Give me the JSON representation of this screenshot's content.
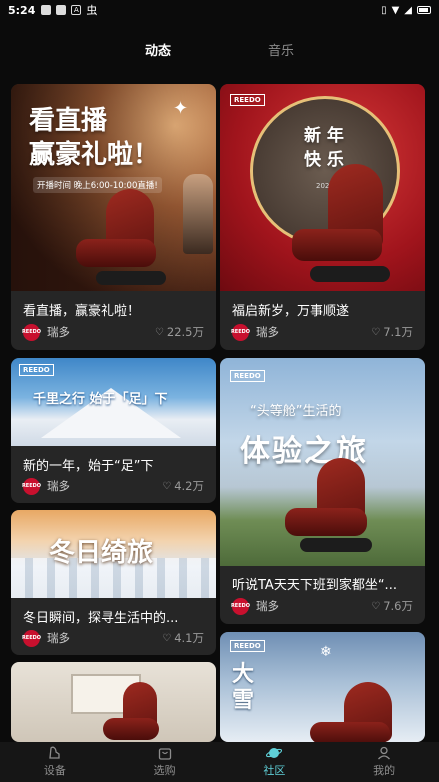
{
  "status": {
    "time": "5:24",
    "icons": [
      "sq-icon",
      "sq-icon",
      "a-icon",
      "bug-icon"
    ],
    "right": [
      "vibrate-icon",
      "data-icon",
      "wifi-icon",
      "signal-icon",
      "battery-icon"
    ]
  },
  "tabs": {
    "active": "动态",
    "inactive": "音乐"
  },
  "brand_tag": "REEDO",
  "cards": [
    {
      "title": "看直播，赢豪礼啦！",
      "author": "瑞多",
      "likes": "22.5万",
      "overlay": "看直播\n赢豪礼啦！",
      "sub": "开播时间  晚上6:00-10:00直播!"
    },
    {
      "title": "福启新岁，万事顺遂",
      "author": "瑞多",
      "likes": "7.1万",
      "overlay": "新 年\n快 乐",
      "sub": "2024"
    },
    {
      "title": "新的一年，始于“足”下",
      "author": "瑞多",
      "likes": "4.2万",
      "overlay": "千里之行  始于「足」下"
    },
    {
      "title": "听说TA天天下班到家都坐“...",
      "author": "瑞多",
      "likes": "7.6万",
      "overlay_small": "“头等舱”生活的",
      "overlay": "体验之旅"
    },
    {
      "title": "冬日瞬间，探寻生活中的...",
      "author": "瑞多",
      "likes": "4.1万",
      "overlay": "冬日绮旅"
    },
    {
      "title": "",
      "author": "",
      "likes": "",
      "overlay": ""
    },
    {
      "title": "",
      "author": "",
      "likes": "",
      "overlay": "大\n雪"
    }
  ],
  "nav": [
    {
      "label": "设备",
      "icon": "device-icon"
    },
    {
      "label": "选购",
      "icon": "shopping-bag-icon"
    },
    {
      "label": "社区",
      "icon": "planet-icon",
      "active": true
    },
    {
      "label": "我的",
      "icon": "user-icon"
    }
  ],
  "colors": {
    "accent": "#5fd0d8",
    "card_bg": "#262626",
    "page_bg": "#0b0b0b",
    "brand_red": "#c8102e"
  }
}
